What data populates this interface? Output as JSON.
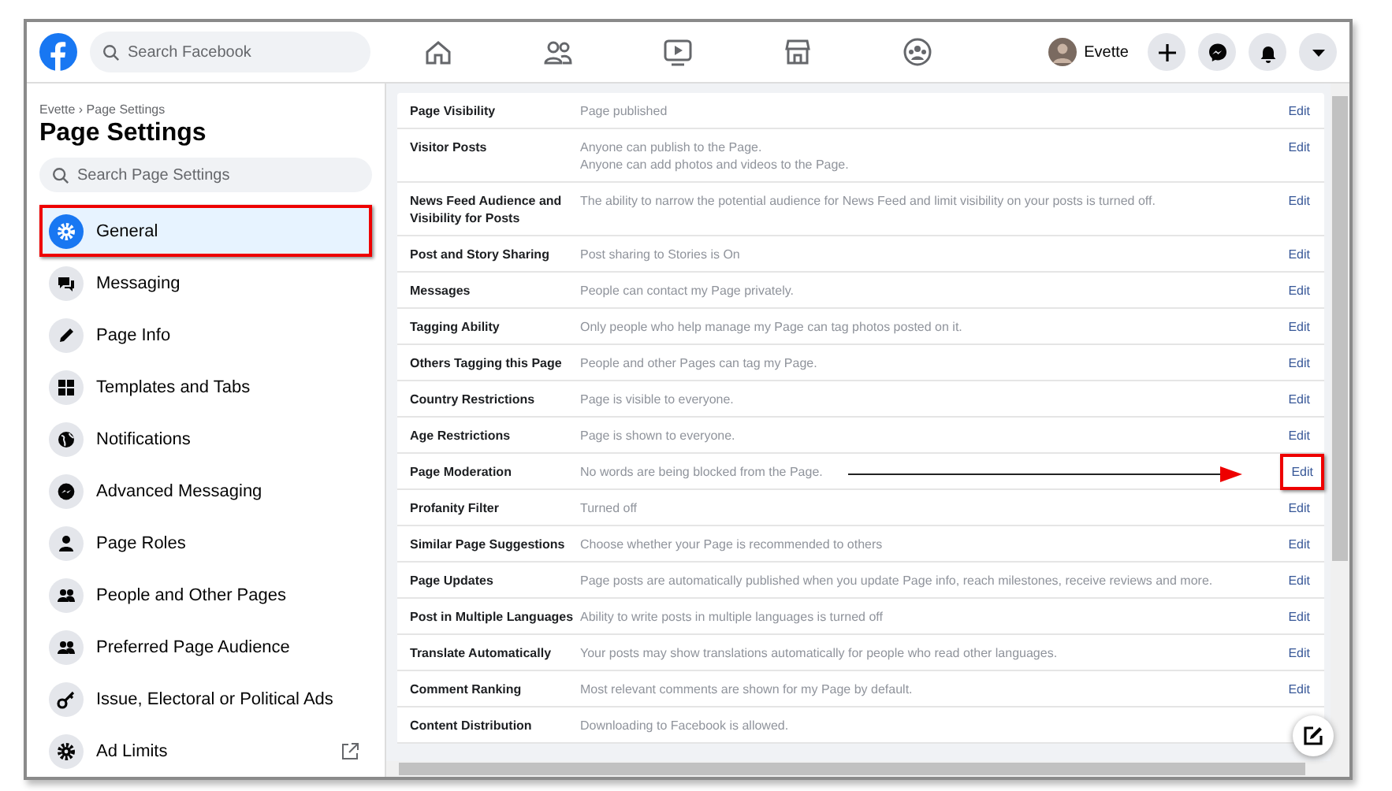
{
  "topbar": {
    "search": {
      "placeholder": "Search Facebook"
    },
    "user_name": "Evette"
  },
  "sidebar": {
    "breadcrumb": "Evette › Page Settings",
    "title": "Page Settings",
    "search": {
      "placeholder": "Search Page Settings"
    },
    "items": [
      {
        "label": "General",
        "selected": true,
        "annotated": true,
        "external": false
      },
      {
        "label": "Messaging",
        "selected": false,
        "annotated": false,
        "external": false
      },
      {
        "label": "Page Info",
        "selected": false,
        "annotated": false,
        "external": false
      },
      {
        "label": "Templates and Tabs",
        "selected": false,
        "annotated": false,
        "external": false
      },
      {
        "label": "Notifications",
        "selected": false,
        "annotated": false,
        "external": false
      },
      {
        "label": "Advanced Messaging",
        "selected": false,
        "annotated": false,
        "external": false
      },
      {
        "label": "Page Roles",
        "selected": false,
        "annotated": false,
        "external": false
      },
      {
        "label": "People and Other Pages",
        "selected": false,
        "annotated": false,
        "external": false
      },
      {
        "label": "Preferred Page Audience",
        "selected": false,
        "annotated": false,
        "external": false
      },
      {
        "label": "Issue, Electoral or Political Ads",
        "selected": false,
        "annotated": false,
        "external": false
      },
      {
        "label": "Ad Limits",
        "selected": false,
        "annotated": false,
        "external": true
      }
    ]
  },
  "settings": [
    {
      "label": "Page Visibility",
      "description": [
        "Page published"
      ],
      "action": "Edit",
      "annotated": false
    },
    {
      "label": "Visitor Posts",
      "description": [
        "Anyone can publish to the Page.",
        "Anyone can add photos and videos to the Page."
      ],
      "action": "Edit",
      "annotated": false
    },
    {
      "label": "News Feed Audience and Visibility for Posts",
      "description": [
        "The ability to narrow the potential audience for News Feed and limit visibility on your posts is turned off."
      ],
      "action": "Edit",
      "annotated": false
    },
    {
      "label": "Post and Story Sharing",
      "description": [
        "Post sharing to Stories is On"
      ],
      "action": "Edit",
      "annotated": false
    },
    {
      "label": "Messages",
      "description": [
        "People can contact my Page privately."
      ],
      "action": "Edit",
      "annotated": false
    },
    {
      "label": "Tagging Ability",
      "description": [
        "Only people who help manage my Page can tag photos posted on it."
      ],
      "action": "Edit",
      "annotated": false
    },
    {
      "label": "Others Tagging this Page",
      "description": [
        "People and other Pages can tag my Page."
      ],
      "action": "Edit",
      "annotated": false
    },
    {
      "label": "Country Restrictions",
      "description": [
        "Page is visible to everyone."
      ],
      "action": "Edit",
      "annotated": false
    },
    {
      "label": "Age Restrictions",
      "description": [
        "Page is shown to everyone."
      ],
      "action": "Edit",
      "annotated": false
    },
    {
      "label": "Page Moderation",
      "description": [
        "No words are being blocked from the Page."
      ],
      "action": "Edit",
      "annotated": true
    },
    {
      "label": "Profanity Filter",
      "description": [
        "Turned off"
      ],
      "action": "Edit",
      "annotated": false
    },
    {
      "label": "Similar Page Suggestions",
      "description": [
        "Choose whether your Page is recommended to others"
      ],
      "action": "Edit",
      "annotated": false
    },
    {
      "label": "Page Updates",
      "description": [
        "Page posts are automatically published when you update Page info, reach milestones, receive reviews and more."
      ],
      "action": "Edit",
      "annotated": false
    },
    {
      "label": "Post in Multiple Languages",
      "description": [
        "Ability to write posts in multiple languages is turned off"
      ],
      "action": "Edit",
      "annotated": false
    },
    {
      "label": "Translate Automatically",
      "description": [
        "Your posts may show translations automatically for people who read other languages."
      ],
      "action": "Edit",
      "annotated": false
    },
    {
      "label": "Comment Ranking",
      "description": [
        "Most relevant comments are shown for my Page by default."
      ],
      "action": "Edit",
      "annotated": false
    },
    {
      "label": "Content Distribution",
      "description": [
        "Downloading to Facebook is allowed."
      ],
      "annotated": false
    }
  ]
}
